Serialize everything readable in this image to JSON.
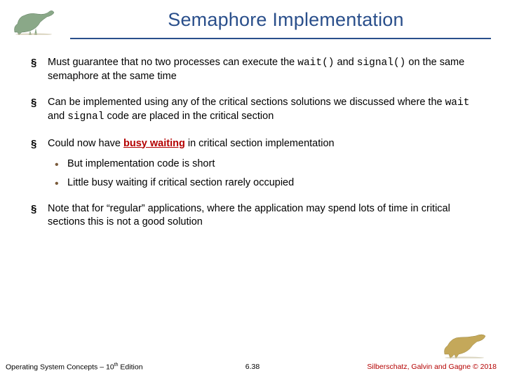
{
  "title": "Semaphore Implementation",
  "bullets": {
    "b1a": "Must guarantee that no two processes can execute  the ",
    "b1_code1": "wait()",
    "b1b": " and ",
    "b1_code2": "signal()",
    "b1c": "  on the same semaphore at the same time",
    "b2a": "Can be implemented using any of the critical sections solutions we discussed where the ",
    "b2_code1": "wait",
    "b2b": " and ",
    "b2_code2": "signal",
    "b2c": " code are placed in the critical section",
    "b3a": "Could now have ",
    "b3_bw": "busy waiting",
    "b3b": " in critical section implementation",
    "b3_sub1": "But implementation code is short",
    "b3_sub2": "Little busy waiting if critical section rarely occupied",
    "b4": "Note that for “regular” applications, where the application may spend lots of time in critical sections this is not a good solution"
  },
  "footer": {
    "left_a": "Operating System Concepts – 10",
    "left_sup": "th",
    "left_b": " Edition",
    "center": "6.38",
    "right": "Silberschatz, Galvin and Gagne © 2018"
  }
}
